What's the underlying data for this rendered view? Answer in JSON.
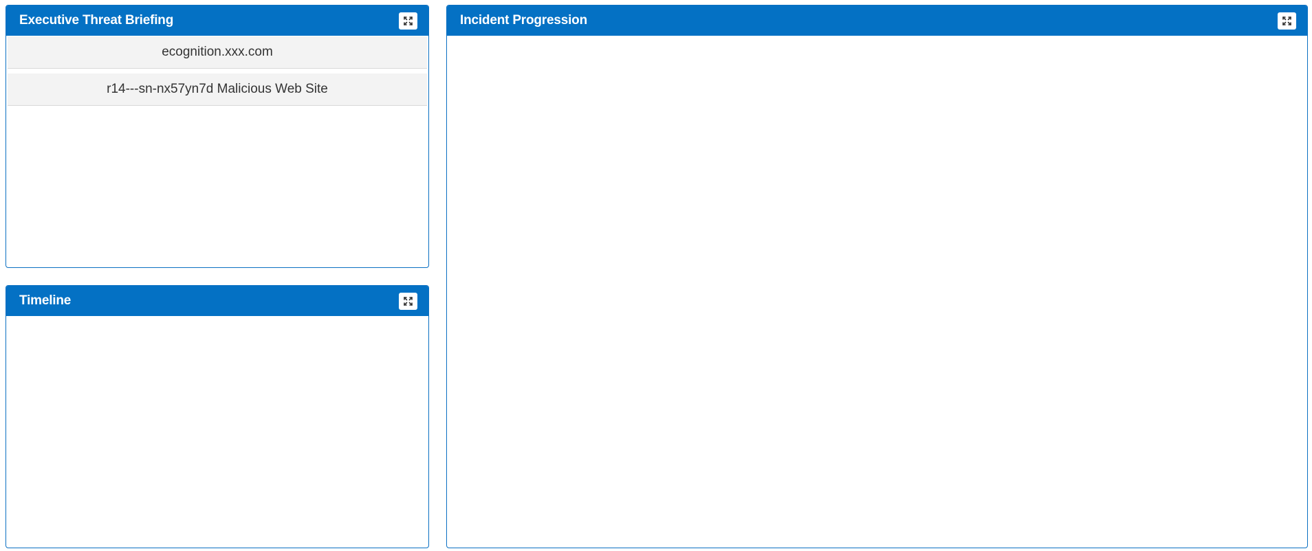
{
  "panels": {
    "briefing": {
      "title": "Executive Threat Briefing",
      "items": [
        {
          "label": "ecognition.xxx.com"
        },
        {
          "label": "r14---sn-nx57yn7d Malicious Web Site"
        }
      ]
    },
    "timeline": {
      "title": "Timeline"
    },
    "incident": {
      "title": "Incident Progression"
    }
  },
  "icons": {
    "expand": "expand-icon"
  },
  "colors": {
    "header": "#0471c4",
    "border": "#0a6fc2",
    "item_bg": "#f3f3f3",
    "item_text": "#333333"
  }
}
